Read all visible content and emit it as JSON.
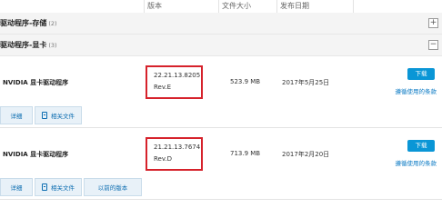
{
  "columns": {
    "version": "版本",
    "file_size": "文件大小",
    "release_date": "发布日期"
  },
  "categories": [
    {
      "title": "驱动程序-存储",
      "count": "(2)",
      "toggle": "+"
    },
    {
      "title": "驱动程序-显卡",
      "count": "(3)",
      "toggle": "−"
    }
  ],
  "drivers": [
    {
      "name": "NVIDIA 显卡驱动程序",
      "version": "22.21.13.8205",
      "revision": "Rev.E",
      "size": "523.9 MB",
      "date": "2017年5月25日",
      "download_label": "下载",
      "terms_label": "遵循使用的条款",
      "tabs": [
        "详细",
        "相关文件"
      ]
    },
    {
      "name": "NVIDIA 显卡驱动程序",
      "version": "21.21.13.7674",
      "revision": "Rev.D",
      "size": "713.9 MB",
      "date": "2017年2月20日",
      "download_label": "下载",
      "terms_label": "遵循使用的条款",
      "tabs": [
        "详细",
        "相关文件",
        "以前的版本"
      ]
    }
  ],
  "colors": {
    "accent": "#0a96d6",
    "highlight_box": "#d6222b"
  }
}
